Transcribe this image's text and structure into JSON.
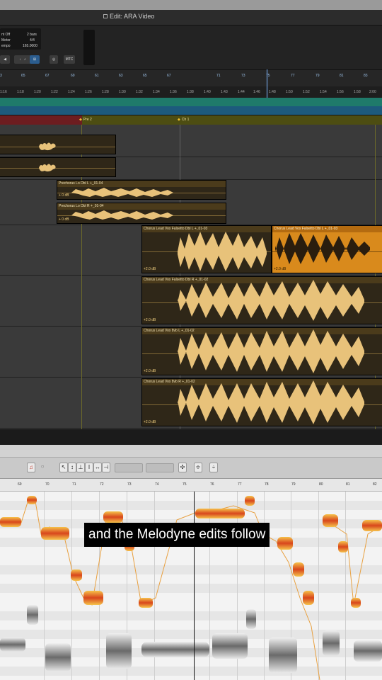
{
  "window": {
    "title": "Edit: ARA Video"
  },
  "counter": {
    "line1_left": "nt Off",
    "line1_right": "2 bars",
    "line2_left": "Meter",
    "line2_right": "4/4",
    "line3_left": "empo",
    "line3_right": "165.0000"
  },
  "toolbar": {
    "mtc_label": "MTC"
  },
  "ruler": {
    "bars": [
      "3",
      "65",
      "67",
      "69",
      "61",
      "63",
      "65",
      "67",
      "71",
      "73",
      "75",
      "77",
      "79",
      "81",
      "83"
    ],
    "minsecs": [
      "1:16",
      "1:18",
      "1:20",
      "1:22",
      "1:24",
      "1:26",
      "1:28",
      "1:30",
      "1:32",
      "1:34",
      "1:36",
      "1:38",
      "1:40",
      "1:43",
      "1:44",
      "1:46",
      "1:48",
      "1:50",
      "1:52",
      "1:54",
      "1:56",
      "1:58",
      "2:00"
    ]
  },
  "markers": [
    {
      "label": "Pre 2"
    },
    {
      "label": "Ch 1"
    }
  ],
  "clips": [
    {
      "name": "Prechorus Lo Dbl L +_01-04",
      "gain": "+ 0 dB"
    },
    {
      "name": "Prechorus Lo Dbl R +_01-04",
      "gain": "+ 0 dB"
    },
    {
      "name": "Chorus Lead Vox Falsetto Dbl L +_01-03",
      "gain": "+2.0 dB"
    },
    {
      "name": "Chorus Lead Vox Falsetto Dbl L +_01-03",
      "gain": "+2.0 dB"
    },
    {
      "name": "Chorus Lead Vox Falsetto Dbl R +_01-02",
      "gain": "+2.0 dB"
    },
    {
      "name": "Chorus Lead Vox 8vb L +_01-02",
      "gain": "+2.0 dB"
    },
    {
      "name": "Chorus Lead Vox 8vb R +_01-02",
      "gain": "+2.0 dB"
    }
  ],
  "melodyne": {
    "ruler": [
      "69",
      "70",
      "71",
      "72",
      "73",
      "74",
      "75",
      "76",
      "77",
      "78",
      "79",
      "80",
      "81",
      "82"
    ]
  },
  "caption": "and the Melodyne edits follow",
  "colors": {
    "clip": "#2f2718",
    "waveform": "#e8c27a",
    "selected_clip": "#d98a1c",
    "melodyne_blob": "#d8461c"
  },
  "icons": [
    "smart-tool-icon",
    "grab-tool-icon",
    "zoom-icon"
  ]
}
